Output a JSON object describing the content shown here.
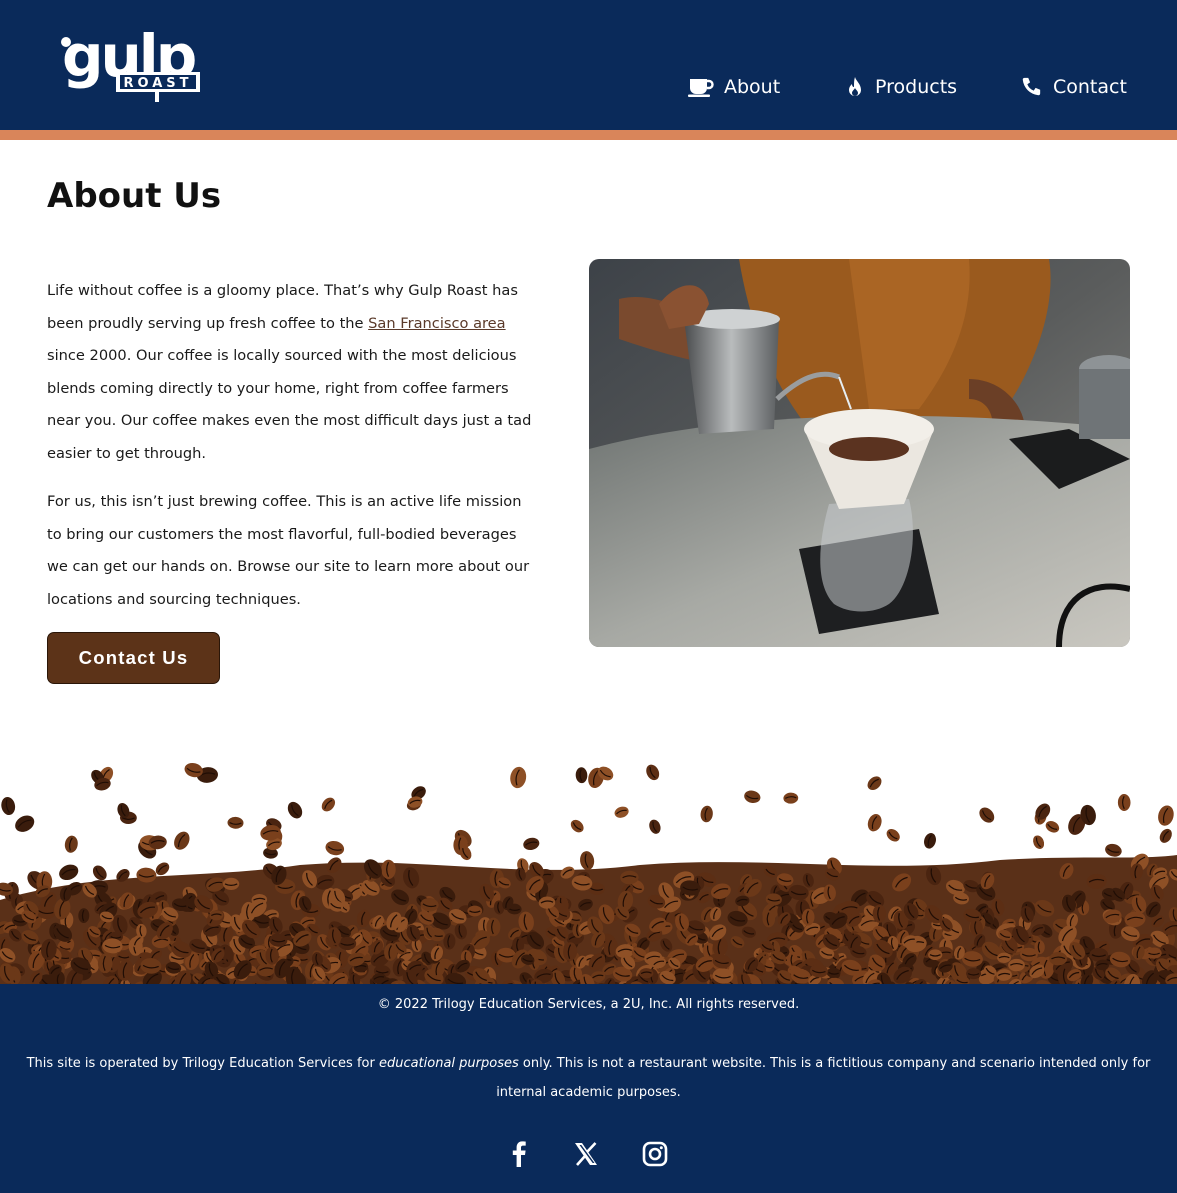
{
  "brand": {
    "logo_main": "gulp",
    "logo_sub": "ROAST"
  },
  "nav": {
    "items": [
      {
        "label": "About",
        "icon": "coffee-cup-icon"
      },
      {
        "label": "Products",
        "icon": "fire-icon"
      },
      {
        "label": "Contact",
        "icon": "phone-icon"
      }
    ]
  },
  "main": {
    "title": "About Us",
    "paragraph1_before": "Life without coffee is a gloomy place. That’s why Gulp Roast has been proudly serving up fresh coffee to the ",
    "paragraph1_link": "San Francisco area",
    "paragraph1_after": " since 2000. Our coffee is locally sourced with the most delicious blends coming directly to your home, right from coffee farmers near you. Our coffee makes even the most difficult days just a tad easier to get through.",
    "paragraph2": "For us, this isn’t just brewing coffee. This is an active life mission to bring our customers the most flavorful, full-bodied beverages we can get our hands on. Browse our site to learn more about our locations and sourcing techniques.",
    "button_label": "Contact Us"
  },
  "footer": {
    "copyright": "© 2022 Trilogy Education Services, a 2U, Inc. All rights reserved.",
    "disclaimer_before": "This site is operated by Trilogy Education Services for ",
    "disclaimer_em": "educational purposes",
    "disclaimer_after": " only. This is not a restaurant website. This is a fictitious company and scenario intended only for internal academic purposes.",
    "social": [
      "facebook-icon",
      "x-icon",
      "instagram-icon"
    ]
  },
  "colors": {
    "header_bg": "#0a2a5a",
    "accent_stripe": "#d9855a",
    "button_bg": "#5c3318",
    "link": "#5a3a2a"
  }
}
